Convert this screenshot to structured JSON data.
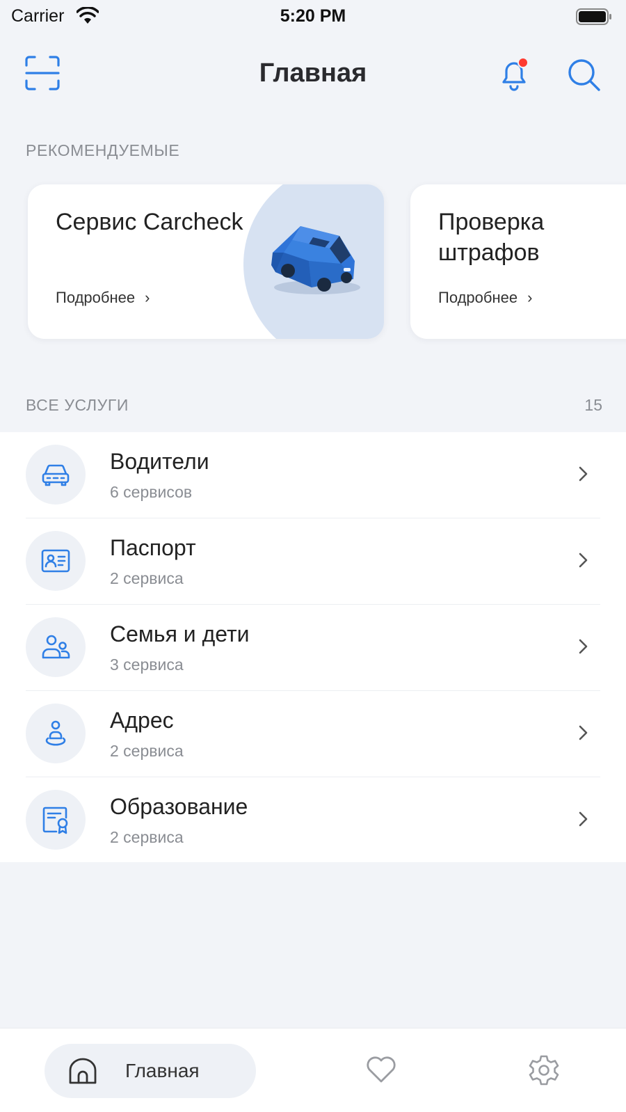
{
  "status_bar": {
    "carrier": "Carrier",
    "time": "5:20 PM"
  },
  "navbar": {
    "title": "Главная",
    "scan_icon": "qr-scan-icon",
    "bell_icon": "bell-icon",
    "search_icon": "search-icon",
    "notification_dot_color": "#ff3b30"
  },
  "recommended": {
    "label": "РЕКОМЕНДУЕМЫЕ",
    "cards": [
      {
        "title": "Сервис Carcheck",
        "more": "Подробнее",
        "chevron": "›",
        "image": "car-illustration"
      },
      {
        "title": "Проверка штрафов",
        "more": "Подробнее",
        "chevron": "›"
      }
    ]
  },
  "all_services": {
    "label": "ВСЕ УСЛУГИ",
    "count": "15",
    "items": [
      {
        "title": "Водители",
        "subtitle": "6 сервисов",
        "icon": "car-icon"
      },
      {
        "title": "Паспорт",
        "subtitle": "2 сервиса",
        "icon": "id-card-icon"
      },
      {
        "title": "Семья и дети",
        "subtitle": "3 сервиса",
        "icon": "family-icon"
      },
      {
        "title": "Адрес",
        "subtitle": "2 сервиса",
        "icon": "location-person-icon"
      },
      {
        "title": "Образование",
        "subtitle": "2 сервиса",
        "icon": "certificate-icon"
      }
    ]
  },
  "tab_bar": {
    "home_label": "Главная",
    "home_icon": "home-icon",
    "favorites_icon": "heart-icon",
    "settings_icon": "gear-icon"
  },
  "colors": {
    "accent": "#2f7fe6",
    "background": "#f2f4f8",
    "icon_bg": "#eef1f6",
    "muted_text": "#8a8d93"
  }
}
